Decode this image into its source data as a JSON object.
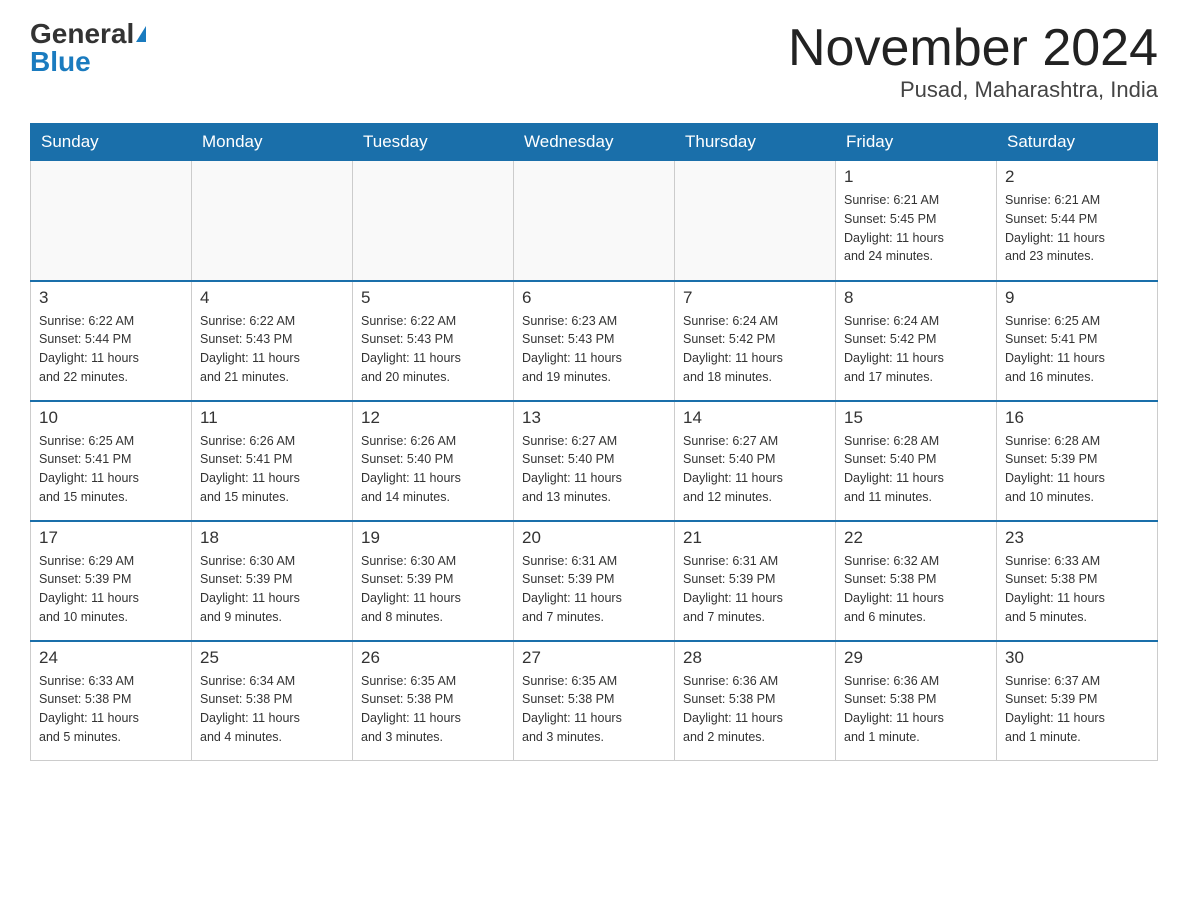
{
  "header": {
    "logo_general": "General",
    "logo_blue": "Blue",
    "month_title": "November 2024",
    "location": "Pusad, Maharashtra, India"
  },
  "days_of_week": [
    "Sunday",
    "Monday",
    "Tuesday",
    "Wednesday",
    "Thursday",
    "Friday",
    "Saturday"
  ],
  "weeks": [
    [
      {
        "day": "",
        "info": ""
      },
      {
        "day": "",
        "info": ""
      },
      {
        "day": "",
        "info": ""
      },
      {
        "day": "",
        "info": ""
      },
      {
        "day": "",
        "info": ""
      },
      {
        "day": "1",
        "info": "Sunrise: 6:21 AM\nSunset: 5:45 PM\nDaylight: 11 hours\nand 24 minutes."
      },
      {
        "day": "2",
        "info": "Sunrise: 6:21 AM\nSunset: 5:44 PM\nDaylight: 11 hours\nand 23 minutes."
      }
    ],
    [
      {
        "day": "3",
        "info": "Sunrise: 6:22 AM\nSunset: 5:44 PM\nDaylight: 11 hours\nand 22 minutes."
      },
      {
        "day": "4",
        "info": "Sunrise: 6:22 AM\nSunset: 5:43 PM\nDaylight: 11 hours\nand 21 minutes."
      },
      {
        "day": "5",
        "info": "Sunrise: 6:22 AM\nSunset: 5:43 PM\nDaylight: 11 hours\nand 20 minutes."
      },
      {
        "day": "6",
        "info": "Sunrise: 6:23 AM\nSunset: 5:43 PM\nDaylight: 11 hours\nand 19 minutes."
      },
      {
        "day": "7",
        "info": "Sunrise: 6:24 AM\nSunset: 5:42 PM\nDaylight: 11 hours\nand 18 minutes."
      },
      {
        "day": "8",
        "info": "Sunrise: 6:24 AM\nSunset: 5:42 PM\nDaylight: 11 hours\nand 17 minutes."
      },
      {
        "day": "9",
        "info": "Sunrise: 6:25 AM\nSunset: 5:41 PM\nDaylight: 11 hours\nand 16 minutes."
      }
    ],
    [
      {
        "day": "10",
        "info": "Sunrise: 6:25 AM\nSunset: 5:41 PM\nDaylight: 11 hours\nand 15 minutes."
      },
      {
        "day": "11",
        "info": "Sunrise: 6:26 AM\nSunset: 5:41 PM\nDaylight: 11 hours\nand 15 minutes."
      },
      {
        "day": "12",
        "info": "Sunrise: 6:26 AM\nSunset: 5:40 PM\nDaylight: 11 hours\nand 14 minutes."
      },
      {
        "day": "13",
        "info": "Sunrise: 6:27 AM\nSunset: 5:40 PM\nDaylight: 11 hours\nand 13 minutes."
      },
      {
        "day": "14",
        "info": "Sunrise: 6:27 AM\nSunset: 5:40 PM\nDaylight: 11 hours\nand 12 minutes."
      },
      {
        "day": "15",
        "info": "Sunrise: 6:28 AM\nSunset: 5:40 PM\nDaylight: 11 hours\nand 11 minutes."
      },
      {
        "day": "16",
        "info": "Sunrise: 6:28 AM\nSunset: 5:39 PM\nDaylight: 11 hours\nand 10 minutes."
      }
    ],
    [
      {
        "day": "17",
        "info": "Sunrise: 6:29 AM\nSunset: 5:39 PM\nDaylight: 11 hours\nand 10 minutes."
      },
      {
        "day": "18",
        "info": "Sunrise: 6:30 AM\nSunset: 5:39 PM\nDaylight: 11 hours\nand 9 minutes."
      },
      {
        "day": "19",
        "info": "Sunrise: 6:30 AM\nSunset: 5:39 PM\nDaylight: 11 hours\nand 8 minutes."
      },
      {
        "day": "20",
        "info": "Sunrise: 6:31 AM\nSunset: 5:39 PM\nDaylight: 11 hours\nand 7 minutes."
      },
      {
        "day": "21",
        "info": "Sunrise: 6:31 AM\nSunset: 5:39 PM\nDaylight: 11 hours\nand 7 minutes."
      },
      {
        "day": "22",
        "info": "Sunrise: 6:32 AM\nSunset: 5:38 PM\nDaylight: 11 hours\nand 6 minutes."
      },
      {
        "day": "23",
        "info": "Sunrise: 6:33 AM\nSunset: 5:38 PM\nDaylight: 11 hours\nand 5 minutes."
      }
    ],
    [
      {
        "day": "24",
        "info": "Sunrise: 6:33 AM\nSunset: 5:38 PM\nDaylight: 11 hours\nand 5 minutes."
      },
      {
        "day": "25",
        "info": "Sunrise: 6:34 AM\nSunset: 5:38 PM\nDaylight: 11 hours\nand 4 minutes."
      },
      {
        "day": "26",
        "info": "Sunrise: 6:35 AM\nSunset: 5:38 PM\nDaylight: 11 hours\nand 3 minutes."
      },
      {
        "day": "27",
        "info": "Sunrise: 6:35 AM\nSunset: 5:38 PM\nDaylight: 11 hours\nand 3 minutes."
      },
      {
        "day": "28",
        "info": "Sunrise: 6:36 AM\nSunset: 5:38 PM\nDaylight: 11 hours\nand 2 minutes."
      },
      {
        "day": "29",
        "info": "Sunrise: 6:36 AM\nSunset: 5:38 PM\nDaylight: 11 hours\nand 1 minute."
      },
      {
        "day": "30",
        "info": "Sunrise: 6:37 AM\nSunset: 5:39 PM\nDaylight: 11 hours\nand 1 minute."
      }
    ]
  ]
}
